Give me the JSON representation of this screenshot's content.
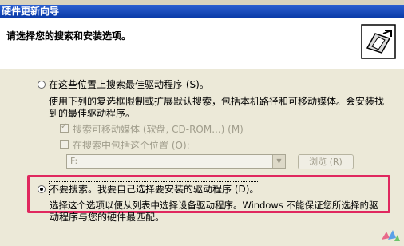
{
  "window": {
    "title": "硬件更新向导"
  },
  "header": {
    "title": "请选择您的搜索和安装选项。",
    "icon": "hardware-wizard-icon"
  },
  "options": {
    "search_label": "在这些位置上搜索最佳驱动程序 (S)。",
    "search_description_1": "使用下列的复选框限制或扩展默认搜索，包括本机路径和可移动媒体。会安装找",
    "search_description_2": "到的最佳驱动程序。",
    "search_removable_label": "搜索可移动媒体 (软盘, CD-ROM...) (M)",
    "include_location_label": "在搜索中包括这个位置 (O):",
    "location_value": "F:",
    "browse_label": "浏览 (R)",
    "dont_search_label": "不要搜索。我要自己选择要安装的驱动程序 (D)。",
    "dont_search_description_1": "选择这个选项以便从列表中选择设备驱动程序。Windows 不能保证您所选择的驱",
    "dont_search_description_2": "动程序与您的硬件最匹配。"
  },
  "colors": {
    "highlight": "#e0285f",
    "title_bar": "#0a3ba8"
  }
}
